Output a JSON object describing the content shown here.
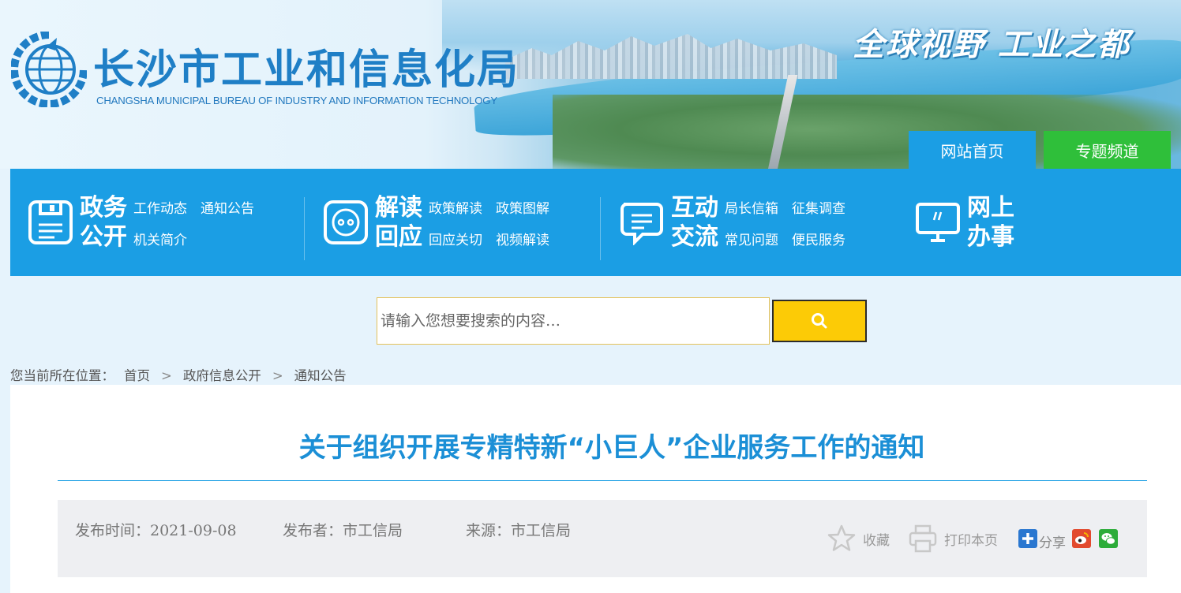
{
  "header": {
    "site_title": "长沙市工业和信息化局",
    "site_subtitle": "CHANGSHA MUNICIPAL BUREAU OF INDUSTRY AND INFORMATION TECHNOLOGY",
    "slogan": "全球视野 工业之都",
    "tabs": [
      {
        "label": "网站首页",
        "color": "#1b9ee4"
      },
      {
        "label": "专题频道",
        "color": "#2fbf3a"
      }
    ]
  },
  "nav": {
    "color": "#1b9ee4",
    "groups": [
      {
        "icon": "floppy-disk-icon",
        "head_top": "政务",
        "head_bottom": "公开",
        "links": [
          "工作动态",
          "通知公告",
          "机关简介"
        ]
      },
      {
        "icon": "chat-face-icon",
        "head_top": "解读",
        "head_bottom": "回应",
        "links": [
          "政策解读",
          "政策图解",
          "回应关切",
          "视频解读"
        ]
      },
      {
        "icon": "speech-bubble-icon",
        "head_top": "互动",
        "head_bottom": "交流",
        "links": [
          "局长信箱",
          "征集调查",
          "常见问题",
          "便民服务"
        ]
      },
      {
        "icon": "monitor-icon",
        "head_top": "网上",
        "head_bottom": "办事",
        "links": []
      }
    ]
  },
  "search": {
    "placeholder": "请输入您想要搜索的内容…",
    "button_color": "#fccb06",
    "button_icon": "search-icon"
  },
  "breadcrumb": {
    "prefix": "您当前所在位置：",
    "items": [
      "首页",
      "政府信息公开",
      "通知公告"
    ]
  },
  "article": {
    "title": "关于组织开展专精特新“小巨人”企业服务工作的通知",
    "publish_time": "发布时间：2021-09-08",
    "publisher": "发布者：市工信局",
    "source": "来源：市工信局",
    "actions": {
      "favorite": "收藏",
      "print": "打印本页",
      "share": "分享"
    }
  }
}
